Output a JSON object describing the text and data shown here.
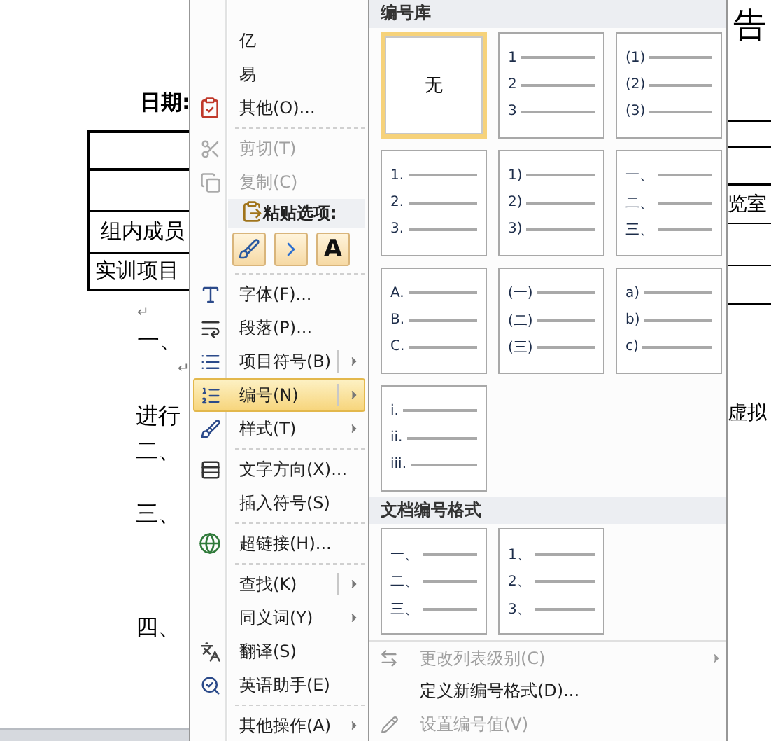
{
  "document": {
    "date_label": "日期:",
    "table_cells": [
      "组内成员",
      "实训项目"
    ],
    "lines": [
      {
        "kind": "mark",
        "text": "↵"
      },
      {
        "kind": "text",
        "text": "一、"
      },
      {
        "kind": "mark",
        "text": "↵"
      },
      {
        "kind": "text",
        "text": "进行"
      },
      {
        "kind": "text",
        "text": "二、"
      },
      {
        "kind": "text",
        "text": "三、"
      },
      {
        "kind": "text",
        "text": "四、"
      }
    ],
    "right_texts": [
      "告",
      "览室",
      "虚拟"
    ]
  },
  "context_menu": {
    "items": [
      {
        "kind": "item",
        "label": "亿",
        "disabled": false,
        "highlighted": false,
        "has_submenu": false,
        "split": false
      },
      {
        "kind": "item",
        "label": "易",
        "disabled": false,
        "highlighted": false,
        "has_submenu": false,
        "split": false
      },
      {
        "kind": "item",
        "label": "其他(O)...",
        "disabled": false,
        "highlighted": false,
        "has_submenu": false,
        "split": false
      },
      {
        "kind": "separator"
      },
      {
        "kind": "item",
        "label": "剪切(T)",
        "disabled": true,
        "highlighted": false,
        "has_submenu": false,
        "split": false
      },
      {
        "kind": "item",
        "label": "复制(C)",
        "disabled": true,
        "highlighted": false,
        "has_submenu": false,
        "split": false
      },
      {
        "kind": "header",
        "label": "粘贴选项:"
      },
      {
        "kind": "paste",
        "options": [
          {
            "kind": "keep-format"
          },
          {
            "kind": "merge"
          },
          {
            "kind": "text-only",
            "label": "A"
          }
        ]
      },
      {
        "kind": "separator"
      },
      {
        "kind": "item",
        "label": "字体(F)...",
        "disabled": false,
        "highlighted": false,
        "has_submenu": false,
        "split": false
      },
      {
        "kind": "item",
        "label": "段落(P)...",
        "disabled": false,
        "highlighted": false,
        "has_submenu": false,
        "split": false
      },
      {
        "kind": "item",
        "label": "项目符号(B)",
        "disabled": false,
        "highlighted": false,
        "has_submenu": true,
        "split": true
      },
      {
        "kind": "item",
        "label": "编号(N)",
        "disabled": false,
        "highlighted": true,
        "has_submenu": true,
        "split": true
      },
      {
        "kind": "item",
        "label": "样式(T)",
        "disabled": false,
        "highlighted": false,
        "has_submenu": true,
        "split": false
      },
      {
        "kind": "separator"
      },
      {
        "kind": "item",
        "label": "文字方向(X)...",
        "disabled": false,
        "highlighted": false,
        "has_submenu": false,
        "split": false
      },
      {
        "kind": "item",
        "label": "插入符号(S)",
        "disabled": false,
        "highlighted": false,
        "has_submenu": false,
        "split": false
      },
      {
        "kind": "separator"
      },
      {
        "kind": "item",
        "label": "超链接(H)...",
        "disabled": false,
        "highlighted": false,
        "has_submenu": false,
        "split": false
      },
      {
        "kind": "separator"
      },
      {
        "kind": "item",
        "label": "查找(K)",
        "disabled": false,
        "highlighted": false,
        "has_submenu": true,
        "split": true
      },
      {
        "kind": "item",
        "label": "同义词(Y)",
        "disabled": false,
        "highlighted": false,
        "has_submenu": true,
        "split": false
      },
      {
        "kind": "item",
        "label": "翻译(S)",
        "disabled": false,
        "highlighted": false,
        "has_submenu": false,
        "split": false
      },
      {
        "kind": "item",
        "label": "英语助手(E)",
        "disabled": false,
        "highlighted": false,
        "has_submenu": false,
        "split": false
      },
      {
        "kind": "separator"
      },
      {
        "kind": "item",
        "label": "其他操作(A)",
        "disabled": false,
        "highlighted": false,
        "has_submenu": true,
        "split": false
      }
    ]
  },
  "numbering": {
    "library_title": "编号库",
    "library": [
      {
        "kind": "none",
        "label": "无",
        "selected": true
      },
      {
        "kind": "list",
        "markers": [
          "1",
          "2",
          "3"
        ],
        "selected": false
      },
      {
        "kind": "list",
        "markers": [
          "(1)",
          "(2)",
          "(3)"
        ],
        "selected": false
      },
      {
        "kind": "list",
        "markers": [
          "1.",
          "2.",
          "3."
        ],
        "selected": false
      },
      {
        "kind": "list",
        "markers": [
          "1)",
          "2)",
          "3)"
        ],
        "selected": false
      },
      {
        "kind": "list",
        "markers": [
          "一、",
          "二、",
          "三、"
        ],
        "selected": false
      },
      {
        "kind": "list",
        "markers": [
          "A.",
          "B.",
          "C."
        ],
        "selected": false
      },
      {
        "kind": "list",
        "markers": [
          "(一)",
          "(二)",
          "(三)"
        ],
        "selected": false
      },
      {
        "kind": "list",
        "markers": [
          "a)",
          "b)",
          "c)"
        ],
        "selected": false
      },
      {
        "kind": "list",
        "markers": [
          "i.",
          "ii.",
          "iii."
        ],
        "selected": false
      }
    ],
    "document_title": "文档编号格式",
    "document_formats": [
      {
        "kind": "list",
        "markers": [
          "一、",
          "二、",
          "三、"
        ],
        "selected": false
      },
      {
        "kind": "list",
        "markers": [
          "1、",
          "2、",
          "3、"
        ],
        "selected": false
      }
    ],
    "commands": [
      {
        "label": "更改列表级别(C)",
        "disabled": true,
        "has_submenu": true
      },
      {
        "label": "定义新编号格式(D)...",
        "disabled": false,
        "has_submenu": false
      },
      {
        "label": "设置编号值(V)",
        "disabled": true,
        "has_submenu": false
      }
    ]
  }
}
